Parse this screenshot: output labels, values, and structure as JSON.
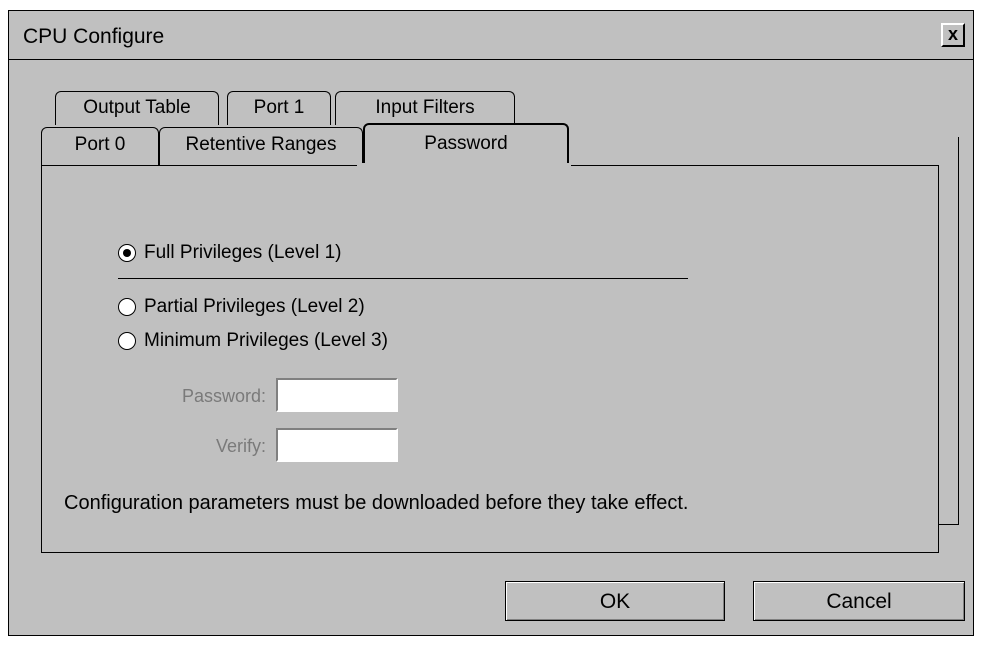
{
  "window": {
    "title": "CPU Configure",
    "close_symbol": "x"
  },
  "tabs": {
    "back_row": [
      "Output Table",
      "Port 1",
      "Input Filters"
    ],
    "front_row": [
      "Port 0",
      "Retentive Ranges",
      "Password"
    ],
    "selected": "Password"
  },
  "privileges": {
    "options": [
      {
        "label": "Full Privileges (Level 1)",
        "selected": true
      },
      {
        "label": "Partial Privileges (Level 2)",
        "selected": false
      },
      {
        "label": "Minimum Privileges (Level 3)",
        "selected": false
      }
    ]
  },
  "fields": {
    "password_label": "Password:",
    "password_value": "",
    "verify_label": "Verify:",
    "verify_value": ""
  },
  "info": "Configuration parameters must be downloaded before they take effect.",
  "buttons": {
    "ok": "OK",
    "cancel": "Cancel"
  },
  "colors": {
    "dialog_bg": "#c0c0c0",
    "disabled_text": "#7a7a7a"
  }
}
